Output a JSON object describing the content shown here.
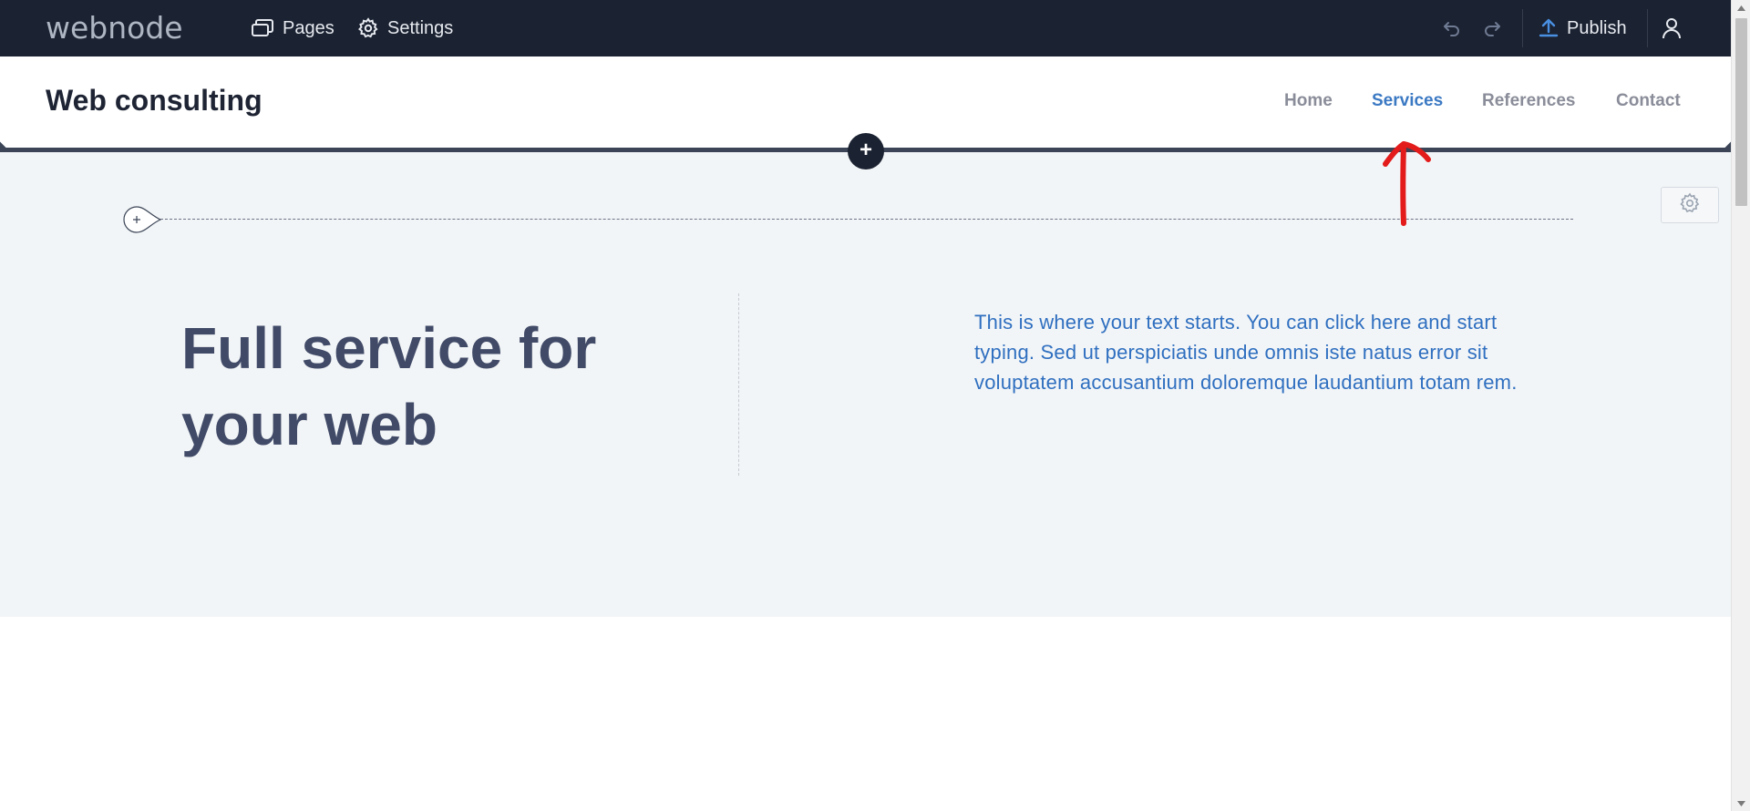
{
  "editor": {
    "logo": "webnode",
    "pages_label": "Pages",
    "settings_label": "Settings",
    "publish_label": "Publish"
  },
  "site": {
    "title": "Web consulting",
    "nav": [
      {
        "label": "Home",
        "active": false
      },
      {
        "label": "Services",
        "active": true
      },
      {
        "label": "References",
        "active": false
      },
      {
        "label": "Contact",
        "active": false
      }
    ]
  },
  "hero": {
    "heading": "Full service for your web",
    "body": "This is where your text starts. You can click here and start typing. Sed ut perspiciatis unde omnis iste natus error sit voluptatem accusantium doloremque laudantium totam rem."
  },
  "icons": {
    "pages": "pages-icon",
    "settings": "gear-icon",
    "undo": "undo-icon",
    "redo": "redo-icon",
    "publish": "upload-icon",
    "user": "user-icon",
    "add_section": "plus-icon",
    "add_row": "plus-icon",
    "section_settings": "gear-icon",
    "annotation": "red-arrow-up-icon"
  },
  "colors": {
    "topbar_bg": "#1b2231",
    "nav_active": "#3b79c3",
    "nav_inactive": "#8a8d99",
    "hero_bg": "#f2f5f7",
    "heading": "#414b68",
    "body_text": "#2f6fc0",
    "publish_icon": "#4a90e2",
    "annotation": "#e31b1b"
  }
}
